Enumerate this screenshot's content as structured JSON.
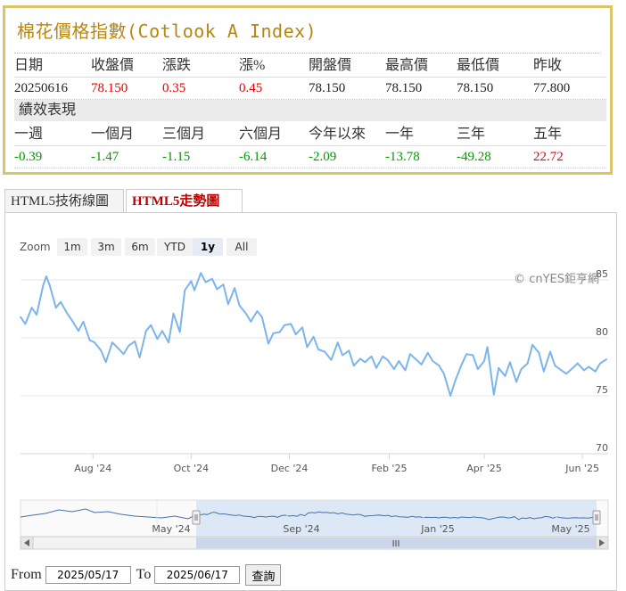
{
  "quote": {
    "title": "棉花價格指數(Cotlook A Index)",
    "headers": [
      "日期",
      "收盤價",
      "漲跌",
      "漲%",
      "開盤價",
      "最高價",
      "最低價",
      "昨收"
    ],
    "values": [
      "20250616",
      "78.150",
      "0.35",
      "0.45",
      "78.150",
      "78.150",
      "78.150",
      "77.800"
    ],
    "value_colors": [
      "plain",
      "red",
      "red",
      "red",
      "plain",
      "plain",
      "plain",
      "plain"
    ],
    "performance_label": "績效表現",
    "perf_headers": [
      "一週",
      "一個月",
      "三個月",
      "六個月",
      "今年以來",
      "一年",
      "三年",
      "五年"
    ],
    "perf_values": [
      "-0.39",
      "-1.47",
      "-1.15",
      "-6.14",
      "-2.09",
      "-13.78",
      "-49.28",
      "22.72"
    ],
    "perf_colors": [
      "green",
      "green",
      "green",
      "green",
      "green",
      "green",
      "green",
      "red"
    ]
  },
  "tabs": [
    {
      "label": "HTML5技術線圖",
      "active": false
    },
    {
      "label": "HTML5走勢圖",
      "active": true
    }
  ],
  "range_selector": {
    "label": "Zoom",
    "buttons": [
      "1m",
      "3m",
      "6m",
      "YTD",
      "1y",
      "All"
    ],
    "active": "1y"
  },
  "credits": "© cnYES鉅亨網",
  "navigator": {
    "labels": [
      "May '24",
      "Sep '24",
      "Jan '25",
      "May '25"
    ],
    "handle_icon": "grip-icon",
    "scroll_grip": "III"
  },
  "date_range": {
    "from_label": "From",
    "from_value": "2025/05/17",
    "to_label": "To",
    "to_value": "2025/06/17",
    "query_label": "查詢"
  },
  "colors": {
    "line": "#7cb5ec",
    "nav_fill": "#d9e6f5",
    "title": "#b8860b"
  },
  "chart_data": {
    "type": "line",
    "title": "",
    "xlabel": "",
    "ylabel": "",
    "ylim": [
      70,
      86
    ],
    "yticks": [
      70,
      75,
      80,
      85
    ],
    "xlim": [
      "2024-06-17",
      "2025-06-17"
    ],
    "xticks": [
      {
        "date": "2024-08-01",
        "label": "Aug '24"
      },
      {
        "date": "2024-10-01",
        "label": "Oct '24"
      },
      {
        "date": "2024-12-01",
        "label": "Dec '24"
      },
      {
        "date": "2025-02-01",
        "label": "Feb '25"
      },
      {
        "date": "2025-04-01",
        "label": "Apr '25"
      },
      {
        "date": "2025-06-01",
        "label": "Jun '25"
      }
    ],
    "grid": true,
    "series": [
      {
        "points": [
          [
            "2024-06-17",
            81.8
          ],
          [
            "2024-06-20",
            81.2
          ],
          [
            "2024-06-24",
            82.6
          ],
          [
            "2024-06-27",
            82.0
          ],
          [
            "2024-07-01",
            84.5
          ],
          [
            "2024-07-03",
            85.3
          ],
          [
            "2024-07-05",
            84.6
          ],
          [
            "2024-07-09",
            82.6
          ],
          [
            "2024-07-12",
            83.1
          ],
          [
            "2024-07-16",
            82.1
          ],
          [
            "2024-07-19",
            81.5
          ],
          [
            "2024-07-23",
            80.6
          ],
          [
            "2024-07-26",
            81.4
          ],
          [
            "2024-07-30",
            79.8
          ],
          [
            "2024-08-02",
            79.6
          ],
          [
            "2024-08-06",
            78.9
          ],
          [
            "2024-08-09",
            77.9
          ],
          [
            "2024-08-13",
            79.6
          ],
          [
            "2024-08-16",
            79.2
          ],
          [
            "2024-08-20",
            78.6
          ],
          [
            "2024-08-23",
            79.3
          ],
          [
            "2024-08-27",
            79.7
          ],
          [
            "2024-08-30",
            78.3
          ],
          [
            "2024-09-03",
            80.6
          ],
          [
            "2024-09-06",
            81.1
          ],
          [
            "2024-09-10",
            79.9
          ],
          [
            "2024-09-13",
            80.6
          ],
          [
            "2024-09-17",
            79.6
          ],
          [
            "2024-09-20",
            82.1
          ],
          [
            "2024-09-24",
            80.5
          ],
          [
            "2024-09-27",
            84.1
          ],
          [
            "2024-10-01",
            84.9
          ],
          [
            "2024-10-03",
            84.1
          ],
          [
            "2024-10-07",
            85.6
          ],
          [
            "2024-10-10",
            84.8
          ],
          [
            "2024-10-14",
            85.1
          ],
          [
            "2024-10-17",
            84.2
          ],
          [
            "2024-10-21",
            84.6
          ],
          [
            "2024-10-24",
            82.9
          ],
          [
            "2024-10-28",
            84.3
          ],
          [
            "2024-10-31",
            82.8
          ],
          [
            "2024-11-04",
            82.1
          ],
          [
            "2024-11-07",
            81.4
          ],
          [
            "2024-11-11",
            82.3
          ],
          [
            "2024-11-14",
            81.8
          ],
          [
            "2024-11-18",
            79.5
          ],
          [
            "2024-11-21",
            80.4
          ],
          [
            "2024-11-25",
            80.5
          ],
          [
            "2024-11-28",
            81.1
          ],
          [
            "2024-12-02",
            81.2
          ],
          [
            "2024-12-05",
            80.3
          ],
          [
            "2024-12-09",
            80.9
          ],
          [
            "2024-12-12",
            79.2
          ],
          [
            "2024-12-16",
            80.1
          ],
          [
            "2024-12-19",
            79.0
          ],
          [
            "2024-12-23",
            78.8
          ],
          [
            "2024-12-27",
            78.1
          ],
          [
            "2024-12-31",
            79.6
          ],
          [
            "2025-01-03",
            78.5
          ],
          [
            "2025-01-07",
            78.9
          ],
          [
            "2025-01-10",
            77.6
          ],
          [
            "2025-01-14",
            78.2
          ],
          [
            "2025-01-17",
            77.9
          ],
          [
            "2025-01-21",
            78.4
          ],
          [
            "2025-01-24",
            77.4
          ],
          [
            "2025-01-28",
            78.4
          ],
          [
            "2025-01-31",
            78.1
          ],
          [
            "2025-02-04",
            77.3
          ],
          [
            "2025-02-07",
            78.0
          ],
          [
            "2025-02-11",
            77.2
          ],
          [
            "2025-02-14",
            78.6
          ],
          [
            "2025-02-18",
            78.1
          ],
          [
            "2025-02-21",
            77.7
          ],
          [
            "2025-02-25",
            78.7
          ],
          [
            "2025-02-28",
            78.0
          ],
          [
            "2025-03-04",
            77.6
          ],
          [
            "2025-03-07",
            76.9
          ],
          [
            "2025-03-11",
            75.0
          ],
          [
            "2025-03-14",
            76.3
          ],
          [
            "2025-03-18",
            77.7
          ],
          [
            "2025-03-21",
            78.6
          ],
          [
            "2025-03-25",
            78.5
          ],
          [
            "2025-03-28",
            77.3
          ],
          [
            "2025-04-01",
            78.0
          ],
          [
            "2025-04-03",
            79.2
          ],
          [
            "2025-04-07",
            75.1
          ],
          [
            "2025-04-10",
            77.4
          ],
          [
            "2025-04-14",
            76.7
          ],
          [
            "2025-04-17",
            77.9
          ],
          [
            "2025-04-21",
            76.2
          ],
          [
            "2025-04-24",
            77.3
          ],
          [
            "2025-04-28",
            77.8
          ],
          [
            "2025-05-01",
            79.4
          ],
          [
            "2025-05-05",
            78.7
          ],
          [
            "2025-05-08",
            77.1
          ],
          [
            "2025-05-12",
            78.8
          ],
          [
            "2025-05-15",
            77.6
          ],
          [
            "2025-05-19",
            77.2
          ],
          [
            "2025-05-22",
            76.9
          ],
          [
            "2025-05-26",
            77.4
          ],
          [
            "2025-05-29",
            77.8
          ],
          [
            "2025-06-02",
            77.2
          ],
          [
            "2025-06-05",
            77.5
          ],
          [
            "2025-06-09",
            77.1
          ],
          [
            "2025-06-12",
            77.8
          ],
          [
            "2025-06-16",
            78.15
          ]
        ]
      }
    ]
  }
}
